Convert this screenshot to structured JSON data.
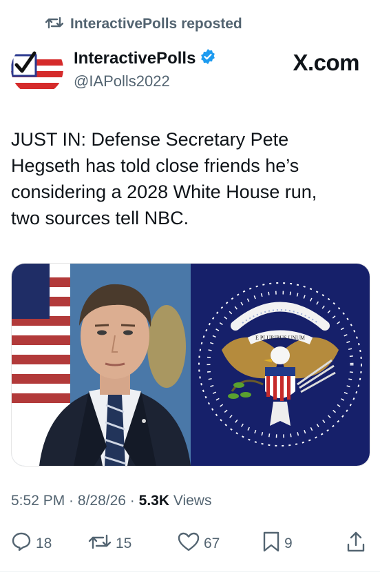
{
  "repost": {
    "label": "InteractivePolls reposted"
  },
  "author": {
    "name": "InteractivePolls",
    "handle": "@IAPolls2022",
    "verified": true
  },
  "source_mark": "X.com",
  "tweet": {
    "lines": [
      "JUST IN: Defense Secretary Pete",
      "Hegseth has told close friends he’s",
      "considering a 2028 White House run,",
      "two sources tell NBC."
    ]
  },
  "seal": {
    "motto": "E PLURIBUS UNUM"
  },
  "meta": {
    "time": "5:52 PM",
    "sep1": " · ",
    "date": "8/28/26",
    "sep2": " · ",
    "views_count": "5.3K",
    "views_label": " Views"
  },
  "actions": {
    "replies": "18",
    "reposts": "15",
    "likes": "67",
    "bookmarks": "9"
  },
  "colors": {
    "accent": "#1d9bf0",
    "secondary_text": "#536471",
    "seal_navy": "#16206a"
  }
}
